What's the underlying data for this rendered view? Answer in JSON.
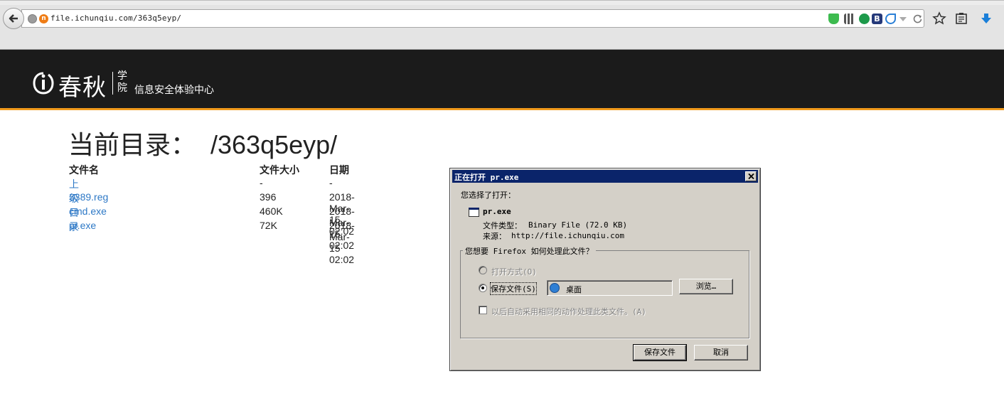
{
  "browser": {
    "url": "file.ichunqiu.com/363q5eyp/",
    "site_icon_letter": "n"
  },
  "site": {
    "logo_name": "春秋",
    "logo_xy": "学院",
    "logo_subtitle": "信息安全体验中心",
    "accent_color": "#f19a1c"
  },
  "listing": {
    "title": "当前目录：  /363q5eyp/",
    "headers": {
      "name": "文件名",
      "size": "文件大小",
      "date": "日期"
    },
    "rows": [
      {
        "name": "上级目录",
        "size": "-",
        "date": "-"
      },
      {
        "name": "3389.reg",
        "size": "396",
        "date": "2018-Mar-15 02:02"
      },
      {
        "name": "cmd.exe",
        "size": "460K",
        "date": "2018-Mar-15 02:02"
      },
      {
        "name": "pr.exe",
        "size": "72K",
        "date": "2018-Mar-15 02:02"
      }
    ]
  },
  "dialog": {
    "title": "正在打开 pr.exe",
    "chosen_label": "您选择了打开：",
    "file_name": "pr.exe",
    "type_label": "文件类型：",
    "type_value": "Binary File (72.0 KB)",
    "source_label": "来源：",
    "source_value": "http://file.ichunqiu.com",
    "group_label": "您想要 Firefox 如何处理此文件？",
    "open_with": "打开方式(O)",
    "save_file_radio": "保存文件(S)",
    "save_folder": "桌面",
    "browse_button": "浏览…",
    "auto_checkbox": "以后自动采用相同的动作处理此类文件。(A)",
    "save_button": "保存文件",
    "cancel_button": "取消"
  }
}
